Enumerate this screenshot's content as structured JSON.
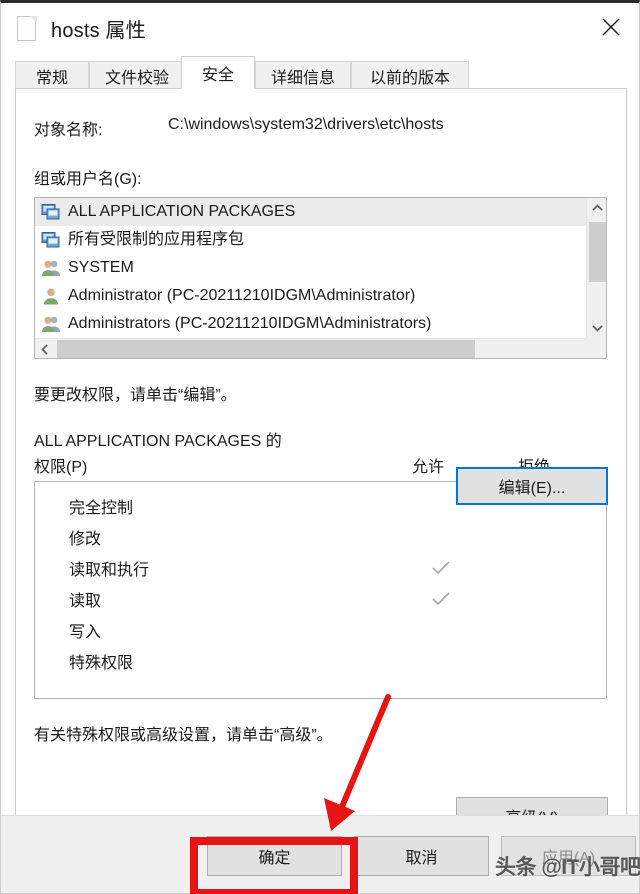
{
  "window": {
    "title": "hosts 属性",
    "icon": "document-icon",
    "close_label": "✕"
  },
  "tabs": [
    {
      "label": "常规",
      "active": false
    },
    {
      "label": "文件校验",
      "active": false
    },
    {
      "label": "安全",
      "active": true
    },
    {
      "label": "详细信息",
      "active": false
    },
    {
      "label": "以前的版本",
      "active": false
    }
  ],
  "security": {
    "object_name_label": "对象名称:",
    "object_name_value": "C:\\windows\\system32\\drivers\\etc\\hosts",
    "group_users_label": "组或用户名(G):",
    "users": [
      {
        "name": "ALL APPLICATION PACKAGES",
        "icon": "app-package-icon",
        "selected": true
      },
      {
        "name": "所有受限制的应用程序包",
        "icon": "app-package-icon",
        "selected": false
      },
      {
        "name": "SYSTEM",
        "icon": "group-icon",
        "selected": false
      },
      {
        "name": "Administrator (PC-20211210IDGM\\Administrator)",
        "icon": "user-icon",
        "selected": false
      },
      {
        "name": "Administrators (PC-20211210IDGM\\Administrators)",
        "icon": "group-icon",
        "selected": false
      }
    ],
    "edit_hint": "要更改权限，请单击“编辑”。",
    "edit_button": "编辑(E)...",
    "permissions_title_line1": "ALL APPLICATION PACKAGES 的",
    "permissions_title_line2": "权限(P)",
    "column_allow": "允许",
    "column_deny": "拒绝",
    "permissions": [
      {
        "name": "完全控制",
        "allow": false,
        "deny": false
      },
      {
        "name": "修改",
        "allow": false,
        "deny": false
      },
      {
        "name": "读取和执行",
        "allow": true,
        "deny": false
      },
      {
        "name": "读取",
        "allow": true,
        "deny": false
      },
      {
        "name": "写入",
        "allow": false,
        "deny": false
      },
      {
        "name": "特殊权限",
        "allow": false,
        "deny": false
      }
    ],
    "advanced_hint": "有关特殊权限或高级设置，请单击“高级”。",
    "advanced_button": "高级(V)"
  },
  "footer": {
    "ok": "确定",
    "cancel": "取消",
    "apply": "应用(A)",
    "apply_disabled": true
  },
  "annotations": {
    "highlight_target": "ok-button",
    "highlight_color": "#e81313",
    "arrow_color": "#e81313",
    "watermark_text": "头条 @IT小哥吧"
  }
}
